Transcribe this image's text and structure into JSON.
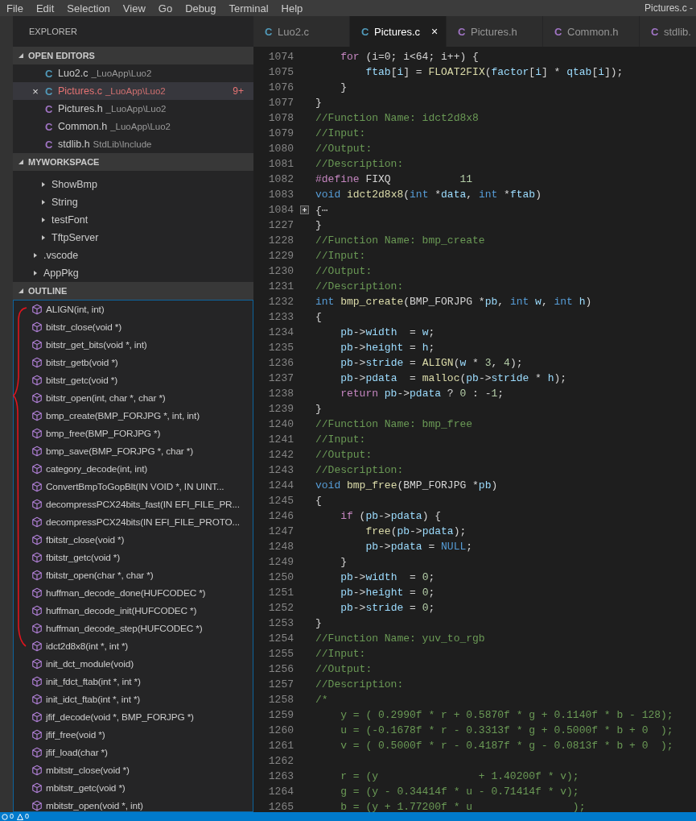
{
  "menu": [
    "File",
    "Edit",
    "Selection",
    "View",
    "Go",
    "Debug",
    "Terminal",
    "Help"
  ],
  "window": {
    "title": "Pictures.c -"
  },
  "sidebar": {
    "title": "EXPLORER",
    "sections": [
      {
        "kind": "editors",
        "title": "OPEN EDITORS",
        "expanded": true,
        "items": [
          {
            "icon": "C",
            "color": "#519aba",
            "name": "Luo2.c",
            "path": "_LuoApp\\Luo2",
            "selected": false
          },
          {
            "icon": "C",
            "color": "#519aba",
            "name": "Pictures.c",
            "path": "_LuoApp\\Luo2",
            "selected": true,
            "problems": "9+",
            "close": "×"
          },
          {
            "icon": "C",
            "color": "#a074c4",
            "name": "Pictures.h",
            "path": "_LuoApp\\Luo2",
            "selected": false
          },
          {
            "icon": "C",
            "color": "#a074c4",
            "name": "Common.h",
            "path": "_LuoApp\\Luo2",
            "selected": false
          },
          {
            "icon": "C",
            "color": "#a074c4",
            "name": "stdlib.h",
            "path": "StdLib\\Include",
            "selected": false
          }
        ]
      },
      {
        "kind": "tree",
        "title": "MYWORKSPACE",
        "expanded": true,
        "items": [
          {
            "children": [
              {
                "label": "ShowBmp",
                "expanded": false
              },
              {
                "label": "String",
                "expanded": false
              },
              {
                "label": "testFont",
                "expanded": false
              },
              {
                "label": "TftpServer",
                "expanded": false
              }
            ]
          },
          {
            "label": ".vscode",
            "expanded": false
          },
          {
            "label": "AppPkg",
            "expanded": false
          }
        ]
      },
      {
        "kind": "outline",
        "title": "OUTLINE",
        "expanded": true,
        "items": [
          "ALIGN(int, int)",
          "bitstr_close(void *)",
          "bitstr_get_bits(void *, int)",
          "bitstr_getb(void *)",
          "bitstr_getc(void *)",
          "bitstr_open(int, char *, char *)",
          "bmp_create(BMP_FORJPG *, int, int)",
          "bmp_free(BMP_FORJPG *)",
          "bmp_save(BMP_FORJPG *, char *)",
          "category_decode(int, int)",
          "ConvertBmpToGopBlt(IN VOID *, IN UINT...",
          "decompressPCX24bits_fast(IN EFI_FILE_PR...",
          "decompressPCX24bits(IN EFI_FILE_PROTO...",
          "fbitstr_close(void *)",
          "fbitstr_getc(void *)",
          "fbitstr_open(char *, char *)",
          "huffman_decode_done(HUFCODEC *)",
          "huffman_decode_init(HUFCODEC *)",
          "huffman_decode_step(HUFCODEC *)",
          "idct2d8x8(int *, int *)",
          "init_dct_module(void)",
          "init_fdct_ftab(int *, int *)",
          "init_idct_ftab(int *, int *)",
          "jfif_decode(void *, BMP_FORJPG *)",
          "jfif_free(void *)",
          "jfif_load(char *)",
          "mbitstr_close(void *)",
          "mbitstr_getc(void *)",
          "mbitstr_open(void *, int)"
        ]
      }
    ]
  },
  "tabs": [
    {
      "icon": "C",
      "color": "#519aba",
      "label": "Luo2.c",
      "selected": false
    },
    {
      "icon": "C",
      "color": "#519aba",
      "label": "Pictures.c",
      "selected": true,
      "close": "×"
    },
    {
      "icon": "C",
      "color": "#a074c4",
      "label": "Pictures.h",
      "selected": false
    },
    {
      "icon": "C",
      "color": "#a074c4",
      "label": "Common.h",
      "selected": false
    },
    {
      "icon": "C",
      "color": "#a074c4",
      "label": "stdlib.",
      "selected": false
    }
  ],
  "code": [
    {
      "num": "1074",
      "tokens": [
        {
          "kind": "ctl",
          "text": "    for"
        },
        {
          "kind": "pl",
          "text": " (i=0; i<64; i++) {"
        }
      ]
    },
    {
      "num": "1075",
      "tokens": [
        {
          "kind": "var",
          "text": "        ftab"
        },
        {
          "kind": "pl",
          "text": "["
        },
        {
          "kind": "var",
          "text": "i"
        },
        {
          "kind": "pl",
          "text": "] = "
        },
        {
          "kind": "fn",
          "text": "FLOAT2FIX"
        },
        {
          "kind": "pl",
          "text": "("
        },
        {
          "kind": "var",
          "text": "factor"
        },
        {
          "kind": "pl",
          "text": "["
        },
        {
          "kind": "var",
          "text": "i"
        },
        {
          "kind": "pl",
          "text": "] * "
        },
        {
          "kind": "var",
          "text": "qtab"
        },
        {
          "kind": "pl",
          "text": "["
        },
        {
          "kind": "var",
          "text": "i"
        },
        {
          "kind": "pl",
          "text": "]);"
        }
      ]
    },
    {
      "num": "1076",
      "tokens": [
        {
          "kind": "pl",
          "text": "    }"
        }
      ]
    },
    {
      "num": "1077",
      "tokens": [
        {
          "kind": "pl",
          "text": "}"
        }
      ]
    },
    {
      "num": "1078",
      "tokens": [
        {
          "kind": "cm",
          "text": "//Function Name: idct2d8x8"
        }
      ]
    },
    {
      "num": "1079",
      "tokens": [
        {
          "kind": "cm",
          "text": "//Input:"
        }
      ]
    },
    {
      "num": "1080",
      "tokens": [
        {
          "kind": "cm",
          "text": "//Output:"
        }
      ]
    },
    {
      "num": "1081",
      "tokens": [
        {
          "kind": "cm",
          "text": "//Description:"
        }
      ]
    },
    {
      "num": "1082",
      "tokens": [
        {
          "kind": "ctl",
          "text": "#define"
        },
        {
          "kind": "pl",
          "text": " FIXQ           "
        },
        {
          "kind": "num",
          "text": "11"
        }
      ]
    },
    {
      "num": "1083",
      "tokens": [
        {
          "kind": "kw",
          "text": "void"
        },
        {
          "kind": "fn",
          "text": " idct2d8x8"
        },
        {
          "kind": "pl",
          "text": "("
        },
        {
          "kind": "kw",
          "text": "int"
        },
        {
          "kind": "pl",
          "text": " *"
        },
        {
          "kind": "var",
          "text": "data"
        },
        {
          "kind": "pl",
          "text": ", "
        },
        {
          "kind": "kw",
          "text": "int"
        },
        {
          "kind": "pl",
          "text": " *"
        },
        {
          "kind": "var",
          "text": "ftab"
        },
        {
          "kind": "pl",
          "text": ")"
        }
      ]
    },
    {
      "num": "1084",
      "folded": true,
      "tokens": [
        {
          "kind": "pl",
          "text": "{"
        },
        {
          "kind": "fold",
          "text": "⋯"
        }
      ]
    },
    {
      "num": "1227",
      "tokens": [
        {
          "kind": "pl",
          "text": "}"
        }
      ]
    },
    {
      "num": "1228",
      "tokens": [
        {
          "kind": "cm",
          "text": "//Function Name: bmp_create"
        }
      ]
    },
    {
      "num": "1229",
      "tokens": [
        {
          "kind": "cm",
          "text": "//Input:"
        }
      ]
    },
    {
      "num": "1230",
      "tokens": [
        {
          "kind": "cm",
          "text": "//Output:"
        }
      ]
    },
    {
      "num": "1231",
      "tokens": [
        {
          "kind": "cm",
          "text": "//Description:"
        }
      ]
    },
    {
      "num": "1232",
      "tokens": [
        {
          "kind": "kw",
          "text": "int"
        },
        {
          "kind": "fn",
          "text": " bmp_create"
        },
        {
          "kind": "pl",
          "text": "(BMP_FORJPG *"
        },
        {
          "kind": "var",
          "text": "pb"
        },
        {
          "kind": "pl",
          "text": ", "
        },
        {
          "kind": "kw",
          "text": "int"
        },
        {
          "kind": "var",
          "text": " w"
        },
        {
          "kind": "pl",
          "text": ", "
        },
        {
          "kind": "kw",
          "text": "int"
        },
        {
          "kind": "var",
          "text": " h"
        },
        {
          "kind": "pl",
          "text": ")"
        }
      ]
    },
    {
      "num": "1233",
      "tokens": [
        {
          "kind": "pl",
          "text": "{"
        }
      ]
    },
    {
      "num": "1234",
      "tokens": [
        {
          "kind": "var",
          "text": "    pb"
        },
        {
          "kind": "pl",
          "text": "->"
        },
        {
          "kind": "var",
          "text": "width"
        },
        {
          "kind": "pl",
          "text": "  = "
        },
        {
          "kind": "var",
          "text": "w"
        },
        {
          "kind": "pl",
          "text": ";"
        }
      ]
    },
    {
      "num": "1235",
      "tokens": [
        {
          "kind": "var",
          "text": "    pb"
        },
        {
          "kind": "pl",
          "text": "->"
        },
        {
          "kind": "var",
          "text": "height"
        },
        {
          "kind": "pl",
          "text": " = "
        },
        {
          "kind": "var",
          "text": "h"
        },
        {
          "kind": "pl",
          "text": ";"
        }
      ]
    },
    {
      "num": "1236",
      "tokens": [
        {
          "kind": "var",
          "text": "    pb"
        },
        {
          "kind": "pl",
          "text": "->"
        },
        {
          "kind": "var",
          "text": "stride"
        },
        {
          "kind": "pl",
          "text": " = "
        },
        {
          "kind": "fn",
          "text": "ALIGN"
        },
        {
          "kind": "pl",
          "text": "("
        },
        {
          "kind": "var",
          "text": "w"
        },
        {
          "kind": "pl",
          "text": " * "
        },
        {
          "kind": "num",
          "text": "3"
        },
        {
          "kind": "pl",
          "text": ", "
        },
        {
          "kind": "num",
          "text": "4"
        },
        {
          "kind": "pl",
          "text": ");"
        }
      ]
    },
    {
      "num": "1237",
      "tokens": [
        {
          "kind": "var",
          "text": "    pb"
        },
        {
          "kind": "pl",
          "text": "->"
        },
        {
          "kind": "var",
          "text": "pdata"
        },
        {
          "kind": "pl",
          "text": "  = "
        },
        {
          "kind": "fn",
          "text": "malloc"
        },
        {
          "kind": "pl",
          "text": "("
        },
        {
          "kind": "var",
          "text": "pb"
        },
        {
          "kind": "pl",
          "text": "->"
        },
        {
          "kind": "var",
          "text": "stride"
        },
        {
          "kind": "pl",
          "text": " * "
        },
        {
          "kind": "var",
          "text": "h"
        },
        {
          "kind": "pl",
          "text": ");"
        }
      ]
    },
    {
      "num": "1238",
      "tokens": [
        {
          "kind": "ctl",
          "text": "    return"
        },
        {
          "kind": "var",
          "text": " pb"
        },
        {
          "kind": "pl",
          "text": "->"
        },
        {
          "kind": "var",
          "text": "pdata"
        },
        {
          "kind": "pl",
          "text": " ? "
        },
        {
          "kind": "num",
          "text": "0"
        },
        {
          "kind": "pl",
          "text": " : -"
        },
        {
          "kind": "num",
          "text": "1"
        },
        {
          "kind": "pl",
          "text": ";"
        }
      ]
    },
    {
      "num": "1239",
      "tokens": [
        {
          "kind": "pl",
          "text": "}"
        }
      ]
    },
    {
      "num": "1240",
      "tokens": [
        {
          "kind": "cm",
          "text": "//Function Name: bmp_free"
        }
      ]
    },
    {
      "num": "1241",
      "tokens": [
        {
          "kind": "cm",
          "text": "//Input:"
        }
      ]
    },
    {
      "num": "1242",
      "tokens": [
        {
          "kind": "cm",
          "text": "//Output:"
        }
      ]
    },
    {
      "num": "1243",
      "tokens": [
        {
          "kind": "cm",
          "text": "//Description:"
        }
      ]
    },
    {
      "num": "1244",
      "tokens": [
        {
          "kind": "kw",
          "text": "void"
        },
        {
          "kind": "fn",
          "text": " bmp_free"
        },
        {
          "kind": "pl",
          "text": "(BMP_FORJPG *"
        },
        {
          "kind": "var",
          "text": "pb"
        },
        {
          "kind": "pl",
          "text": ")"
        }
      ]
    },
    {
      "num": "1245",
      "tokens": [
        {
          "kind": "pl",
          "text": "{"
        }
      ]
    },
    {
      "num": "1246",
      "tokens": [
        {
          "kind": "ctl",
          "text": "    if"
        },
        {
          "kind": "pl",
          "text": " ("
        },
        {
          "kind": "var",
          "text": "pb"
        },
        {
          "kind": "pl",
          "text": "->"
        },
        {
          "kind": "var",
          "text": "pdata"
        },
        {
          "kind": "pl",
          "text": ") {"
        }
      ]
    },
    {
      "num": "1247",
      "tokens": [
        {
          "kind": "fn",
          "text": "        free"
        },
        {
          "kind": "pl",
          "text": "("
        },
        {
          "kind": "var",
          "text": "pb"
        },
        {
          "kind": "pl",
          "text": "->"
        },
        {
          "kind": "var",
          "text": "pdata"
        },
        {
          "kind": "pl",
          "text": ");"
        }
      ]
    },
    {
      "num": "1248",
      "tokens": [
        {
          "kind": "var",
          "text": "        pb"
        },
        {
          "kind": "pl",
          "text": "->"
        },
        {
          "kind": "var",
          "text": "pdata"
        },
        {
          "kind": "pl",
          "text": " = "
        },
        {
          "kind": "kw",
          "text": "NULL"
        },
        {
          "kind": "pl",
          "text": ";"
        }
      ]
    },
    {
      "num": "1249",
      "tokens": [
        {
          "kind": "pl",
          "text": "    }"
        }
      ]
    },
    {
      "num": "1250",
      "tokens": [
        {
          "kind": "var",
          "text": "    pb"
        },
        {
          "kind": "pl",
          "text": "->"
        },
        {
          "kind": "var",
          "text": "width"
        },
        {
          "kind": "pl",
          "text": "  = "
        },
        {
          "kind": "num",
          "text": "0"
        },
        {
          "kind": "pl",
          "text": ";"
        }
      ]
    },
    {
      "num": "1251",
      "tokens": [
        {
          "kind": "var",
          "text": "    pb"
        },
        {
          "kind": "pl",
          "text": "->"
        },
        {
          "kind": "var",
          "text": "height"
        },
        {
          "kind": "pl",
          "text": " = "
        },
        {
          "kind": "num",
          "text": "0"
        },
        {
          "kind": "pl",
          "text": ";"
        }
      ]
    },
    {
      "num": "1252",
      "tokens": [
        {
          "kind": "var",
          "text": "    pb"
        },
        {
          "kind": "pl",
          "text": "->"
        },
        {
          "kind": "var",
          "text": "stride"
        },
        {
          "kind": "pl",
          "text": " = "
        },
        {
          "kind": "num",
          "text": "0"
        },
        {
          "kind": "pl",
          "text": ";"
        }
      ]
    },
    {
      "num": "1253",
      "tokens": [
        {
          "kind": "pl",
          "text": "}"
        }
      ]
    },
    {
      "num": "1254",
      "tokens": [
        {
          "kind": "cm",
          "text": "//Function Name: yuv_to_rgb"
        }
      ]
    },
    {
      "num": "1255",
      "tokens": [
        {
          "kind": "cm",
          "text": "//Input:"
        }
      ]
    },
    {
      "num": "1256",
      "tokens": [
        {
          "kind": "cm",
          "text": "//Output:"
        }
      ]
    },
    {
      "num": "1257",
      "tokens": [
        {
          "kind": "cm",
          "text": "//Description:"
        }
      ]
    },
    {
      "num": "1258",
      "tokens": [
        {
          "kind": "cm",
          "text": "/*"
        }
      ]
    },
    {
      "num": "1259",
      "tokens": [
        {
          "kind": "cm",
          "text": "    y = ( 0.2990f * r + 0.5870f * g + 0.1140f * b - 128);"
        }
      ]
    },
    {
      "num": "1260",
      "tokens": [
        {
          "kind": "cm",
          "text": "    u = (-0.1678f * r - 0.3313f * g + 0.5000f * b + 0  );"
        }
      ]
    },
    {
      "num": "1261",
      "tokens": [
        {
          "kind": "cm",
          "text": "    v = ( 0.5000f * r - 0.4187f * g - 0.0813f * b + 0  );"
        }
      ]
    },
    {
      "num": "1262"
    },
    {
      "num": "1263",
      "tokens": [
        {
          "kind": "cm",
          "text": "    r = (y                + 1.40200f * v);"
        }
      ]
    },
    {
      "num": "1264",
      "tokens": [
        {
          "kind": "cm",
          "text": "    g = (y - 0.34414f * u - 0.71414f * v);"
        }
      ]
    },
    {
      "num": "1265",
      "tokens": [
        {
          "kind": "cm",
          "text": "    b = (y + 1.77200f * u                );"
        }
      ]
    }
  ],
  "status_bar": [
    {
      "kind": "errors",
      "count": "0"
    },
    {
      "kind": "warnings",
      "count": "0"
    }
  ]
}
